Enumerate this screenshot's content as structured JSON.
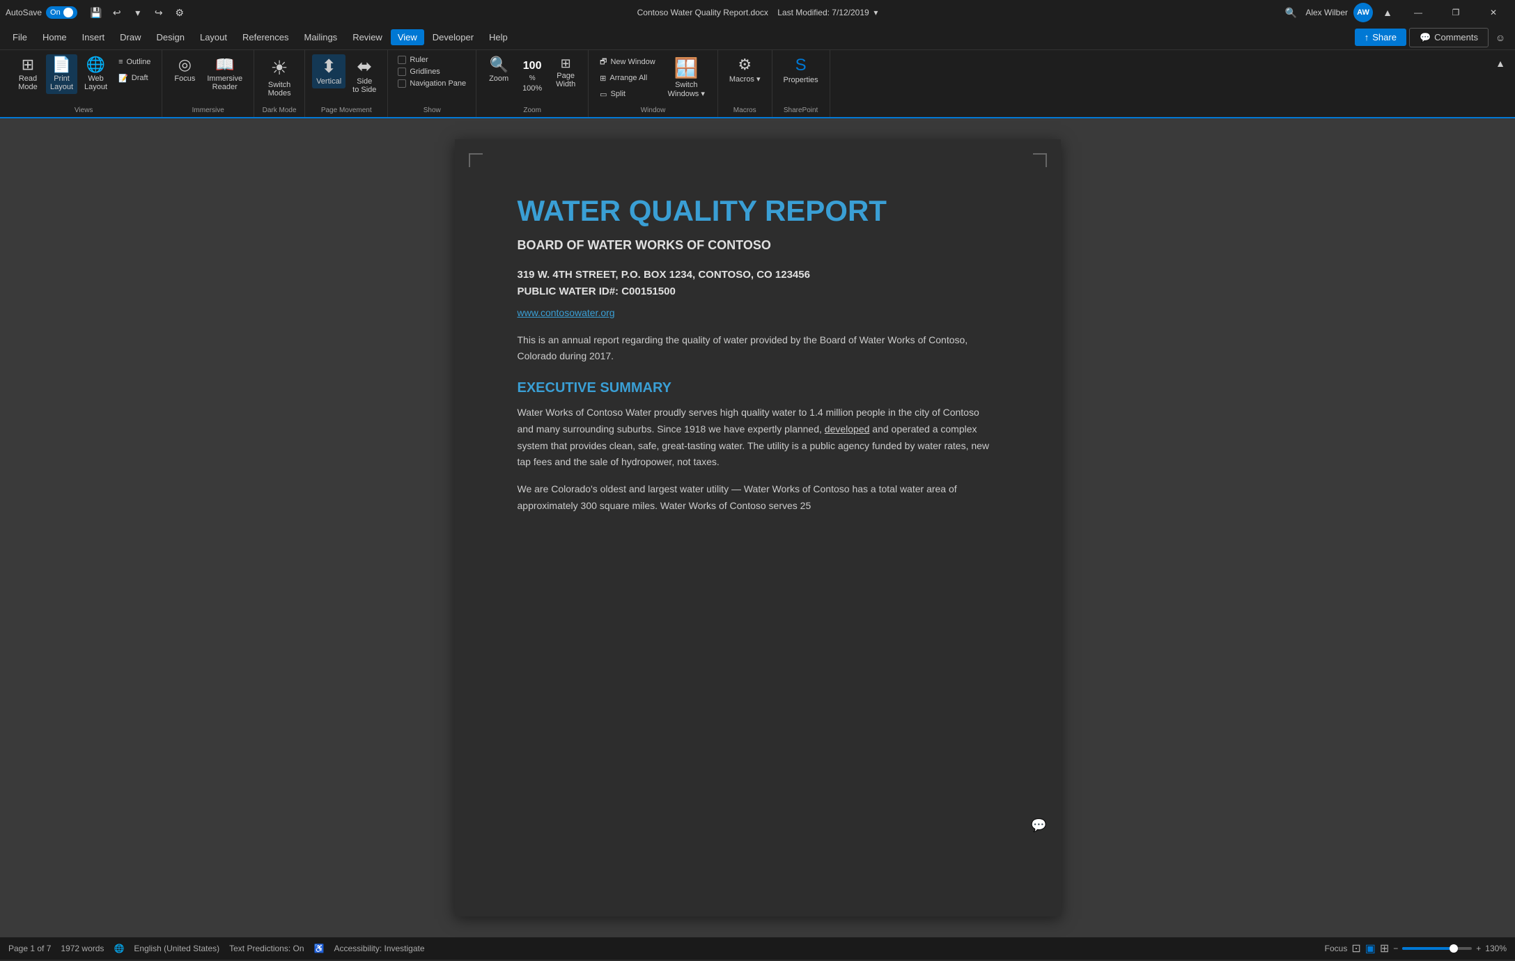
{
  "titleBar": {
    "autosave": "AutoSave",
    "on": "On",
    "fileName": "Contoso Water Quality Report.docx",
    "lastModified": "Last Modified: 7/12/2019",
    "userName": "Alex Wilber",
    "userInitials": "AW",
    "undoIcon": "↩",
    "redoIcon": "↪",
    "saveIcon": "💾",
    "minimize": "—",
    "restore": "❐",
    "close": "✕"
  },
  "menuBar": {
    "items": [
      {
        "label": "File",
        "active": false
      },
      {
        "label": "Home",
        "active": false
      },
      {
        "label": "Insert",
        "active": false
      },
      {
        "label": "Draw",
        "active": false
      },
      {
        "label": "Design",
        "active": false
      },
      {
        "label": "Layout",
        "active": false
      },
      {
        "label": "References",
        "active": false
      },
      {
        "label": "Mailings",
        "active": false
      },
      {
        "label": "Review",
        "active": false
      },
      {
        "label": "View",
        "active": true
      },
      {
        "label": "Developer",
        "active": false
      },
      {
        "label": "Help",
        "active": false
      }
    ],
    "shareLabel": "Share",
    "commentsLabel": "Comments"
  },
  "ribbon": {
    "groups": [
      {
        "name": "Views",
        "buttons": [
          {
            "id": "read-mode",
            "label": "Read\nMode",
            "icon": "⊞",
            "active": false
          },
          {
            "id": "print-layout",
            "label": "Print\nLayout",
            "icon": "📄",
            "active": true
          },
          {
            "id": "web-layout",
            "label": "Web\nLayout",
            "icon": "🌐",
            "active": false
          }
        ],
        "smallButtons": [
          {
            "id": "outline",
            "label": "Outline",
            "icon": "≡"
          },
          {
            "id": "draft",
            "label": "Draft",
            "icon": "📝"
          }
        ]
      },
      {
        "name": "Immersive",
        "buttons": [
          {
            "id": "focus",
            "label": "Focus",
            "icon": "◎"
          },
          {
            "id": "immersive-reader",
            "label": "Immersive\nReader",
            "icon": "📖"
          }
        ]
      },
      {
        "name": "Dark Mode",
        "buttons": [
          {
            "id": "switch-modes",
            "label": "Switch\nModes",
            "icon": "☀"
          }
        ]
      },
      {
        "name": "Page Movement",
        "buttons": [
          {
            "id": "vertical",
            "label": "Vertical",
            "icon": "⬍",
            "active": true
          },
          {
            "id": "side-to-side",
            "label": "Side\nto Side",
            "icon": "⬌"
          }
        ]
      },
      {
        "name": "Show",
        "checkboxes": [
          {
            "id": "ruler",
            "label": "Ruler",
            "checked": false
          },
          {
            "id": "gridlines",
            "label": "Gridlines",
            "checked": false
          },
          {
            "id": "navigation-pane",
            "label": "Navigation Pane",
            "checked": false
          }
        ]
      },
      {
        "name": "Zoom",
        "zoomIcon": "🔍",
        "zoomPercent": "100%",
        "zoomLabel": "100%",
        "pageWidthIcon": "↔"
      },
      {
        "name": "Window",
        "windowButtons": [
          {
            "id": "new-window",
            "label": "New Window",
            "icon": "🗗"
          },
          {
            "id": "arrange-all",
            "label": "Arrange All",
            "icon": "⊞"
          },
          {
            "id": "split",
            "label": "Split",
            "icon": "▭"
          }
        ],
        "switchWindows": {
          "id": "switch-windows",
          "label": "Switch\nWindows",
          "icon": "🪟"
        }
      },
      {
        "name": "Macros",
        "buttons": [
          {
            "id": "macros",
            "label": "Macros",
            "icon": "⚙"
          }
        ]
      },
      {
        "name": "SharePoint",
        "buttons": [
          {
            "id": "properties",
            "label": "Properties",
            "icon": "🅢"
          }
        ]
      }
    ]
  },
  "document": {
    "title": "WATER QUALITY REPORT",
    "subtitle": "BOARD OF WATER WORKS OF CONTOSO",
    "address1": "319 W. 4TH STREET, P.O. BOX 1234, CONTOSO, CO 123456",
    "address2": "PUBLIC WATER ID#: C00151500",
    "website": "www.contosowater.org",
    "intro": "This is an annual report regarding the quality of water provided by the Board of Water Works of Contoso, Colorado during 2017.",
    "sectionTitle": "EXECUTIVE SUMMARY",
    "sectionBody1": "Water Works of Contoso Water proudly serves high quality water to 1.4 million people in the city of Contoso and many surrounding suburbs. Since 1918 we have expertly planned, developed and operated a complex system that provides clean, safe, great-tasting water. The utility is a public agency funded by water rates, new tap fees and the sale of hydropower, not taxes.",
    "sectionBody2": "We are Colorado's oldest and largest water utility — Water Works of Contoso has a total water area of approximately 300 square miles. Water Works of Contoso serves 25"
  },
  "statusBar": {
    "page": "Page 1 of 7",
    "words": "1972 words",
    "language": "English (United States)",
    "textPredictions": "Text Predictions: On",
    "accessibility": "Accessibility: Investigate",
    "focus": "Focus",
    "zoomPercent": "130%",
    "zoomMinus": "−",
    "zoomPlus": "+"
  }
}
